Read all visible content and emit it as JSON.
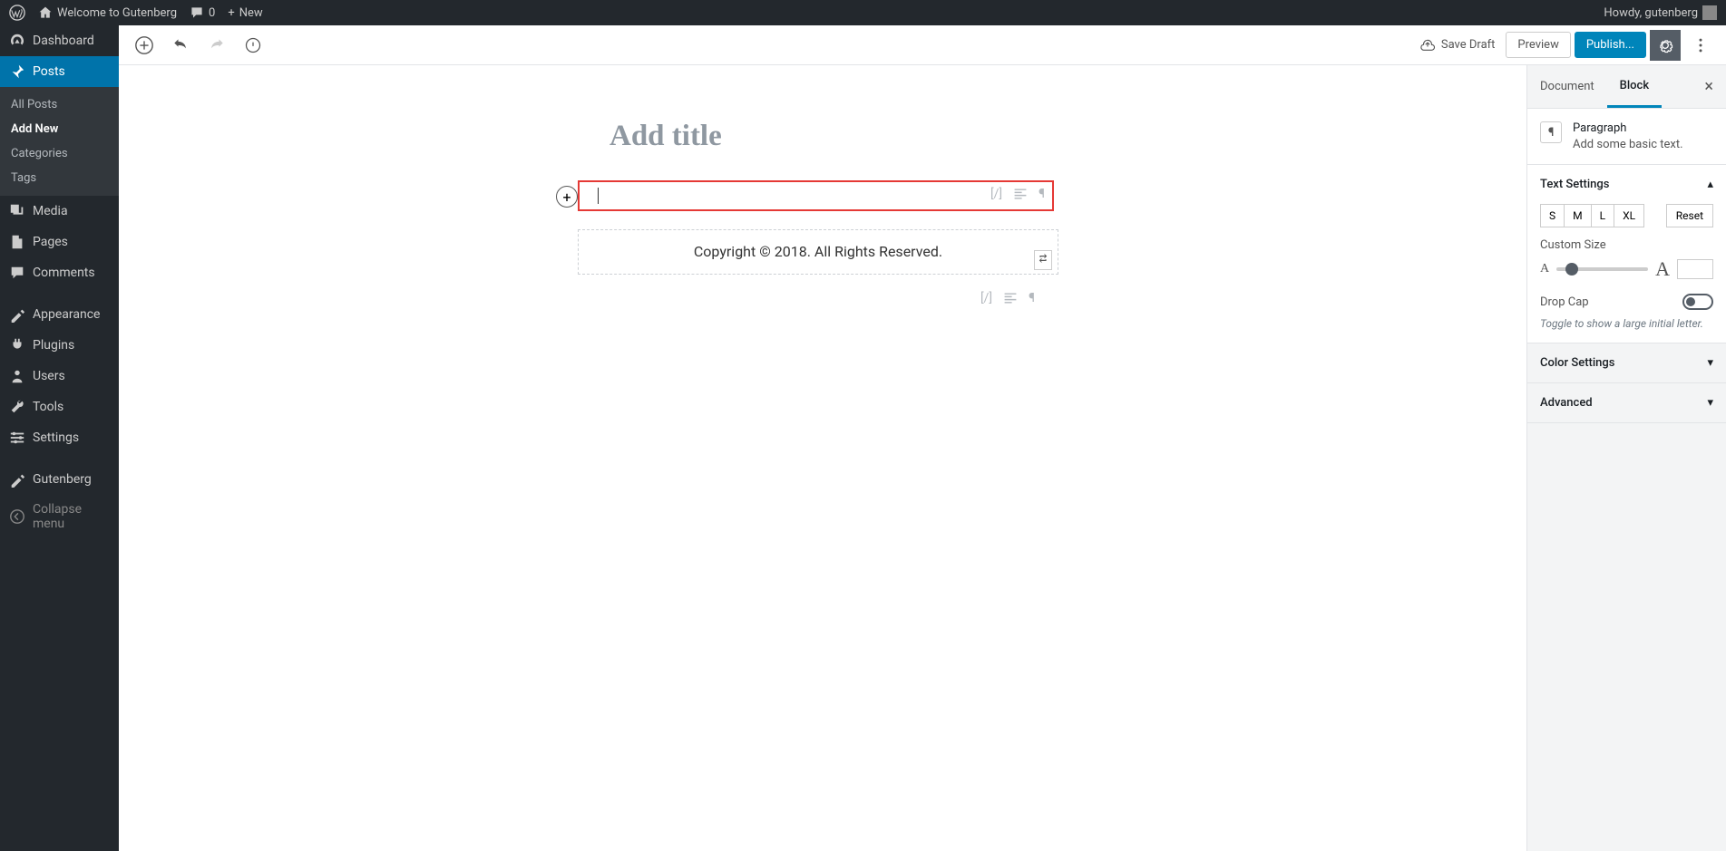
{
  "adminBar": {
    "siteTitle": "Welcome to Gutenberg",
    "commentsCount": "0",
    "newLabel": "New",
    "greeting": "Howdy, gutenberg"
  },
  "adminMenu": {
    "dashboard": "Dashboard",
    "posts": "Posts",
    "postsSub": {
      "all": "All Posts",
      "addNew": "Add New",
      "categories": "Categories",
      "tags": "Tags"
    },
    "media": "Media",
    "pages": "Pages",
    "comments": "Comments",
    "appearance": "Appearance",
    "plugins": "Plugins",
    "users": "Users",
    "tools": "Tools",
    "settings": "Settings",
    "gutenberg": "Gutenberg",
    "collapse": "Collapse menu"
  },
  "editor": {
    "saveDraft": "Save Draft",
    "preview": "Preview",
    "publish": "Publish...",
    "titlePlaceholder": "Add title",
    "reusableText": "Copyright © 2018. All Rights Reserved."
  },
  "sidebar": {
    "tabs": {
      "document": "Document",
      "block": "Block"
    },
    "blockInfo": {
      "title": "Paragraph",
      "desc": "Add some basic text."
    },
    "textSettings": {
      "heading": "Text Settings",
      "sizes": {
        "s": "S",
        "m": "M",
        "l": "L",
        "xl": "XL"
      },
      "reset": "Reset",
      "customSize": "Custom Size",
      "sliderSmallA": "A",
      "sliderBigA": "A",
      "dropCap": "Drop Cap",
      "dropCapHint": "Toggle to show a large initial letter."
    },
    "colorSettings": "Color Settings",
    "advanced": "Advanced"
  }
}
